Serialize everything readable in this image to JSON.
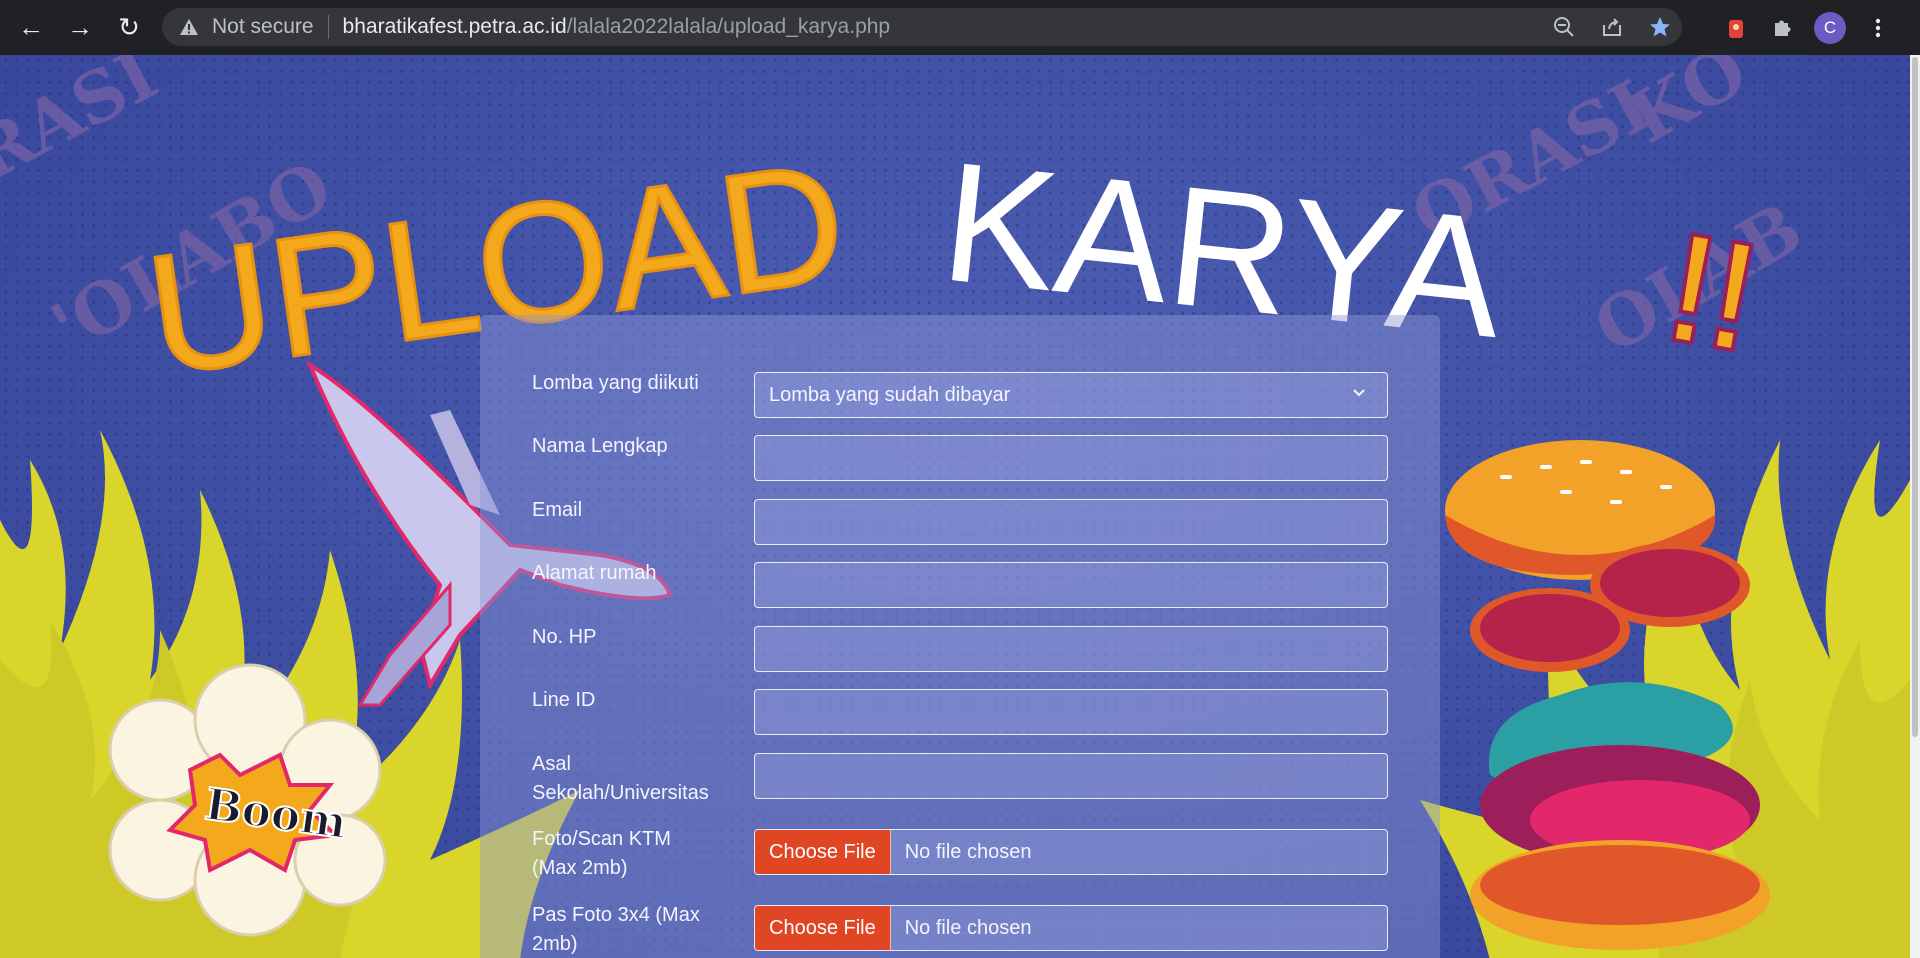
{
  "browser": {
    "security_label": "Not secure",
    "url_host": "bharatikafest.petra.ac.id",
    "url_path": "/lalala2022lalala/upload_karya.php",
    "profile_initial": "C",
    "accent": "#8ab4f8"
  },
  "page": {
    "title_word1": "UPLOAD",
    "title_word2": "KARYA",
    "title_exclaim": "!!",
    "boom_text": "Boom",
    "colors": {
      "title_orange": "#f4a91d",
      "title_white": "#ffffff",
      "background": "#3f4fa3",
      "file_button": "#e04624",
      "flame_yellow": "#d9d52a"
    }
  },
  "form": {
    "lomba": {
      "label": "Lomba yang diikuti",
      "selected": "Lomba yang sudah dibayar"
    },
    "nama": {
      "label": "Nama Lengkap",
      "value": ""
    },
    "email": {
      "label": "Email",
      "value": ""
    },
    "alamat": {
      "label": "Alamat rumah",
      "value": ""
    },
    "hp": {
      "label": "No. HP",
      "value": ""
    },
    "line": {
      "label": "Line ID",
      "value": ""
    },
    "asal": {
      "label": "Asal Sekolah/Universitas",
      "value": ""
    },
    "ktm": {
      "label": "Foto/Scan KTM (Max 2mb)",
      "button": "Choose File",
      "status": "No file chosen"
    },
    "pasfoto": {
      "label": "Pas Foto 3x4 (Max 2mb)",
      "button": "Choose File",
      "status": "No file chosen"
    }
  }
}
